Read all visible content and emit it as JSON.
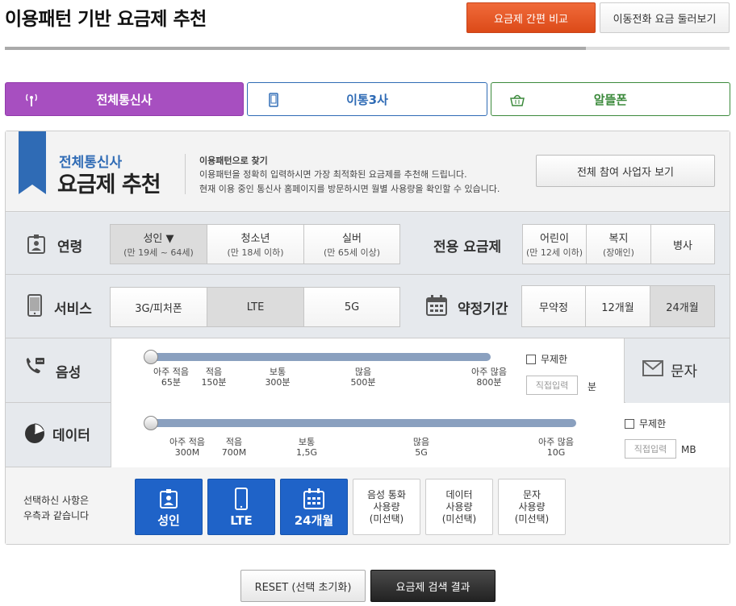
{
  "title": "이용패턴 기반 요금제 추천",
  "top_buttons": {
    "compare": "요금제 간편 비교",
    "browse": "이동전화 요금 둘러보기"
  },
  "tabs": [
    {
      "label": "전체통신사",
      "icon": "antenna-icon",
      "color": "#a74fc0",
      "active": true
    },
    {
      "label": "이통3사",
      "icon": "phone-icon",
      "color": "#2f6bb5",
      "active": false
    },
    {
      "label": "알뜰폰",
      "icon": "basket-icon",
      "color": "#3c8a3c",
      "active": false
    }
  ],
  "header": {
    "sub": "전체통신사",
    "main": "요금제 추천",
    "desc": [
      "이용패턴으로 찾기",
      "이용패턴을 정확히 입력하시면 가장 최적화된 요금제를 추천해 드립니다.",
      "현재 이용 중인 통신사 홈페이지를 방문하시면 월별 사용량을 확인할 수 있습니다."
    ],
    "partners_button": "전체 참여 사업자 보기"
  },
  "age": {
    "label": "연령",
    "options": [
      {
        "main": "성인 ▼",
        "sub": "(만 19세 ~ 64세)",
        "selected": true
      },
      {
        "main": "청소년",
        "sub": "(만 18세 이하)",
        "selected": false
      },
      {
        "main": "실버",
        "sub": "(만 65세 이상)",
        "selected": false
      }
    ]
  },
  "special": {
    "label": "전용 요금제",
    "options": [
      {
        "main": "어린이",
        "sub": "(만 12세 이하)"
      },
      {
        "main": "복지",
        "sub": "(장애인)"
      },
      {
        "main": "병사",
        "sub": ""
      }
    ]
  },
  "service": {
    "label": "서비스",
    "options": [
      {
        "main": "3G/피처폰",
        "selected": false
      },
      {
        "main": "LTE",
        "selected": true
      },
      {
        "main": "5G",
        "selected": false
      }
    ]
  },
  "contract": {
    "label": "약정기간",
    "options": [
      {
        "main": "무약정",
        "selected": false
      },
      {
        "main": "12개월",
        "selected": false
      },
      {
        "main": "24개월",
        "selected": true
      }
    ]
  },
  "voice": {
    "label": "음성",
    "ticks": [
      {
        "l1": "아주 적음",
        "l2": "65분"
      },
      {
        "l1": "적음",
        "l2": "150분"
      },
      {
        "l1": "보통",
        "l2": "300분"
      },
      {
        "l1": "많음",
        "l2": "500분"
      },
      {
        "l1": "아주 많음",
        "l2": "800분"
      }
    ],
    "slider_value": 0,
    "unlimited": "무제한",
    "direct_placeholder": "직접입력",
    "unit": "분"
  },
  "message": {
    "label": "문자"
  },
  "data": {
    "label": "데이터",
    "ticks": [
      {
        "l1": "아주 적음",
        "l2": "300M"
      },
      {
        "l1": "적음",
        "l2": "700M"
      },
      {
        "l1": "보통",
        "l2": "1,5G"
      },
      {
        "l1": "많음",
        "l2": "5G"
      },
      {
        "l1": "아주 많음",
        "l2": "10G"
      }
    ],
    "slider_value": 0,
    "unlimited": "무제한",
    "direct_placeholder": "직접입력",
    "unit": "MB"
  },
  "summary": {
    "text_1": "선택하신 사항은",
    "text_2": "우측과 같습니다",
    "chips": [
      {
        "label": "성인",
        "icon": "id-card-icon",
        "active": true
      },
      {
        "label": "LTE",
        "icon": "smartphone-icon",
        "active": true
      },
      {
        "label": "24개월",
        "icon": "calendar-icon",
        "active": true
      },
      {
        "l1": "음성 통화",
        "l2": "사용량",
        "l3": "(미선택)",
        "active": false
      },
      {
        "l1": "데이터",
        "l2": "사용량",
        "l3": "(미선택)",
        "active": false
      },
      {
        "l1": "문자",
        "l2": "사용량",
        "l3": "(미선택)",
        "active": false
      }
    ]
  },
  "bottom_buttons": {
    "reset": "RESET (선택 초기화)",
    "search": "요금제 검색 결과"
  }
}
